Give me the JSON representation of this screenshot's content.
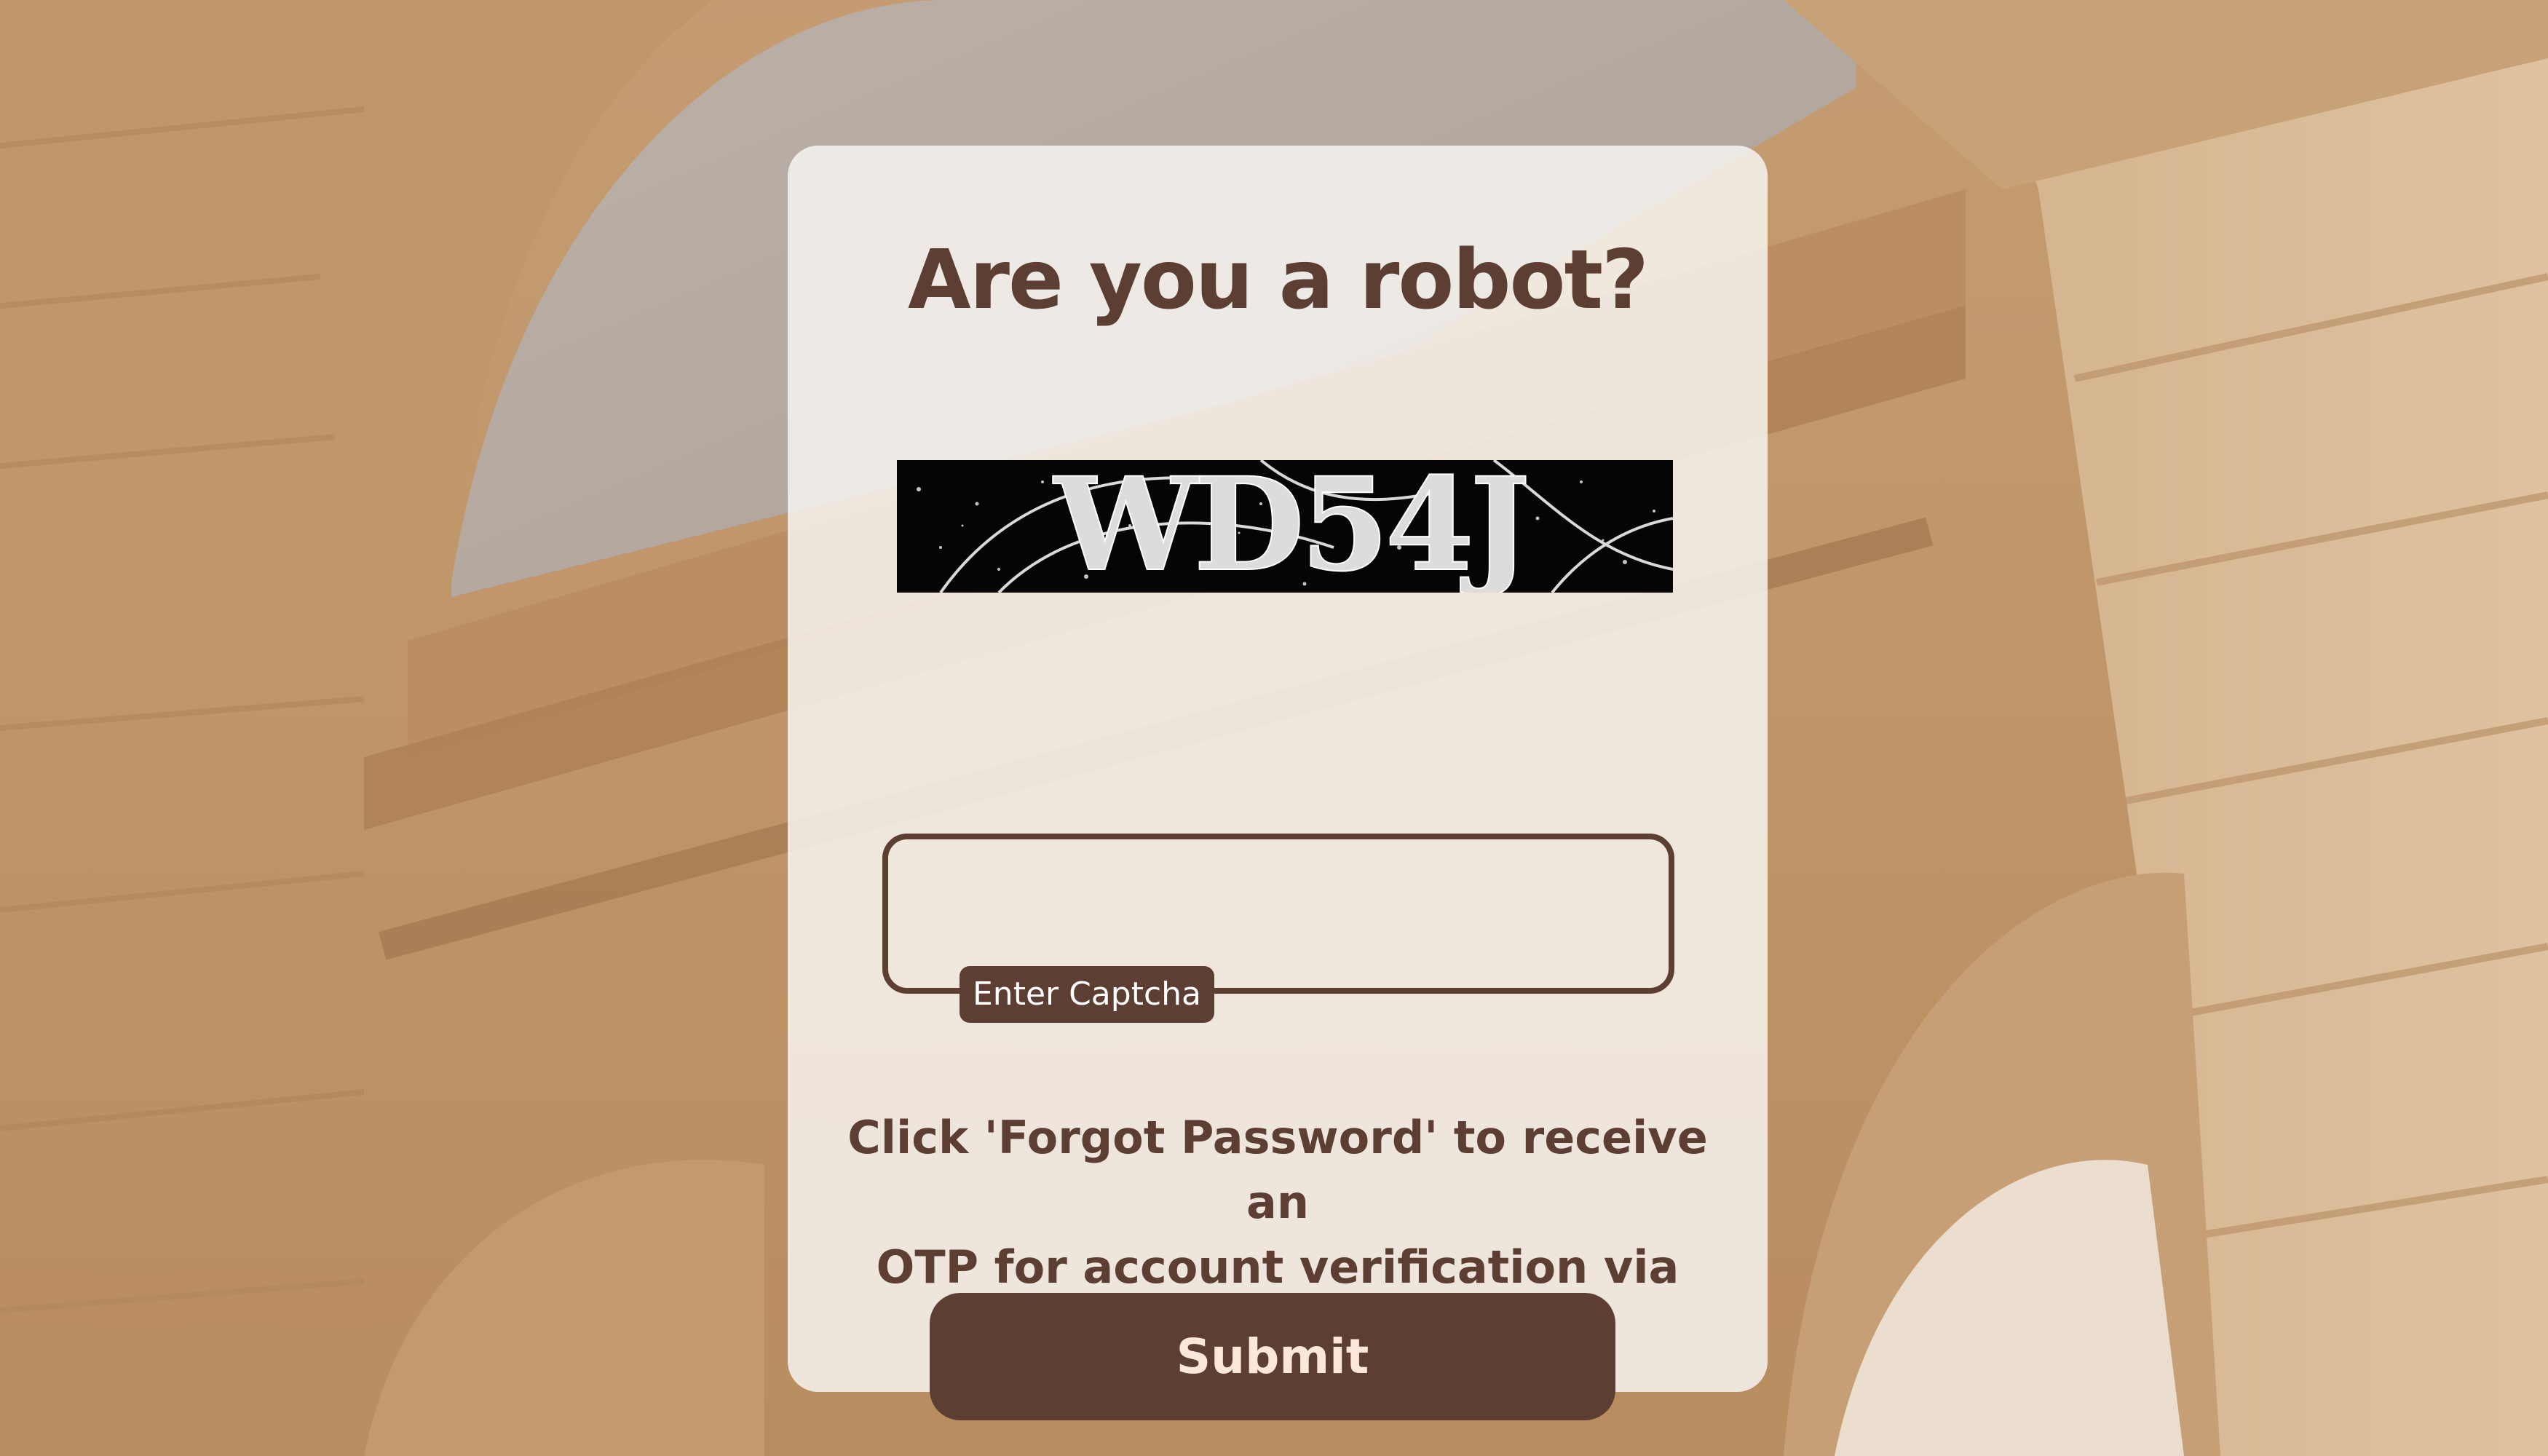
{
  "page": {
    "title": "Are you a robot?",
    "background_description": "sandstone-arch",
    "colors": {
      "card_background": "#f7f3f0",
      "brand_brown": "#5d3e33",
      "submit_text": "#fde7da",
      "background_stone": "#c9a67e"
    }
  },
  "captcha": {
    "image_text": "WD54J",
    "input_value": "",
    "input_label": "Enter Captcha"
  },
  "info": {
    "message_line1": "Click 'Forgot Password' to receive an",
    "message_line2": "OTP for account verification via email"
  },
  "actions": {
    "submit_label": "Submit"
  }
}
